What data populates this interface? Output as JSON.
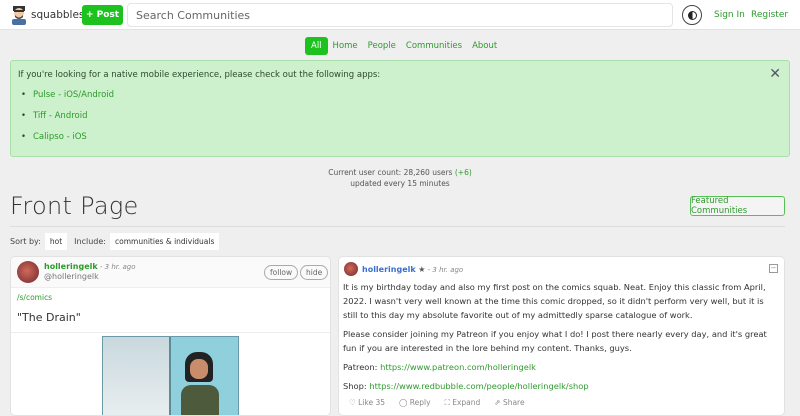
{
  "header": {
    "brand": "squabbles",
    "post_label": "+ Post",
    "search_placeholder": "Search Communities",
    "sign_in": "Sign In",
    "register": "Register"
  },
  "nav": [
    {
      "label": "All",
      "active": true
    },
    {
      "label": "Home"
    },
    {
      "label": "People"
    },
    {
      "label": "Communities"
    },
    {
      "label": "About"
    }
  ],
  "alert": {
    "text": "If you're looking for a native mobile experience, please check out the following apps:",
    "apps": [
      "Pulse - iOS/Android",
      "Tiff - Android",
      "Calipso - iOS"
    ]
  },
  "stats": {
    "prefix": "Current user count: 28,260 users",
    "delta": "(+6)",
    "update": "updated every 15 minutes"
  },
  "page": {
    "title": "Front Page",
    "featured": "Featured Communities",
    "sort_label": "Sort by:",
    "sort_value": "hot",
    "include_label": "Include:",
    "include_value": "communities & individuals"
  },
  "left_post": {
    "author": "holleringelk",
    "time": " - 3 hr. ago",
    "handle": "@holleringelk",
    "follow": "follow",
    "hide": "hide",
    "community": "/s/comics",
    "title": "\"The Drain\""
  },
  "right_post": {
    "author": "holleringelk",
    "time": " - 3 hr. ago",
    "p1": "It is my birthday today and also my first post on the comics squab. Neat. Enjoy this classic from April, 2022. I wasn't very well known at the time this comic dropped, so it didn't perform very well, but it is still to this day my absolute favorite out of my admittedly sparse catalogue of work.",
    "p2": "Please consider joining my Patreon if you enjoy what I do! I post there nearly every day, and it's great fun if you are interested in the lore behind my content. Thanks, guys.",
    "patreon_label": "Patreon: ",
    "patreon_url": "https://www.patreon.com/holleringelk",
    "shop_label": "Shop: ",
    "shop_url": "https://www.redbubble.com/people/holleringelk/shop",
    "like": "Like 35",
    "reply": "Reply",
    "expand": "Expand",
    "share": "Share"
  }
}
